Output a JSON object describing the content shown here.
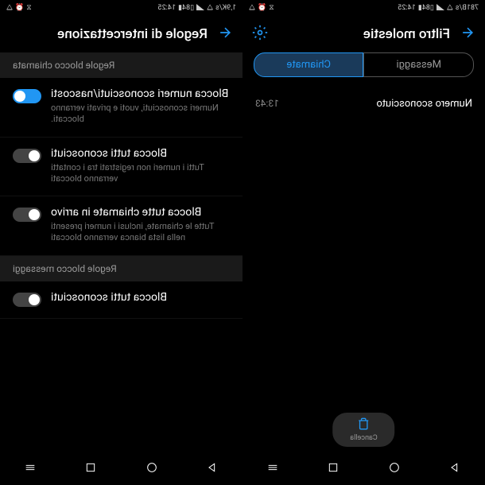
{
  "left": {
    "statusTime": "14:25",
    "statusSpeed": "781B/s",
    "batteryText": "84",
    "headerTitle": "Filtro molestie",
    "tabs": {
      "messages": "Messaggi",
      "calls": "Chiamate"
    },
    "entry": {
      "label": "Numero sconosciuto",
      "time": "13:43"
    },
    "deleteLabel": "Cancella"
  },
  "right": {
    "statusTime": "14:25",
    "statusSpeed": "1,9K/s",
    "batteryText": "84",
    "headerTitle": "Regole di intercettazione",
    "sectionCalls": "Regole blocco chiamata",
    "sectionMsgs": "Regole blocco messaggi",
    "rows": {
      "r1": {
        "title": "Blocca numeri sconosciuti/nascosti",
        "sub": "Numeri sconosciuti, vuoti e privati verranno bloccati."
      },
      "r2": {
        "title": "Blocca tutti sconosciuti",
        "sub": "Tutti i numeri non registrati tra i contatti verranno bloccati"
      },
      "r3": {
        "title": "Blocca tutte chiamate in arrivo",
        "sub": "Tutte le chiamate, inclusi i numeri presenti nella lista bianca verranno bloccati"
      },
      "r4": {
        "title": "Blocca tutti sconosciuti"
      }
    }
  }
}
